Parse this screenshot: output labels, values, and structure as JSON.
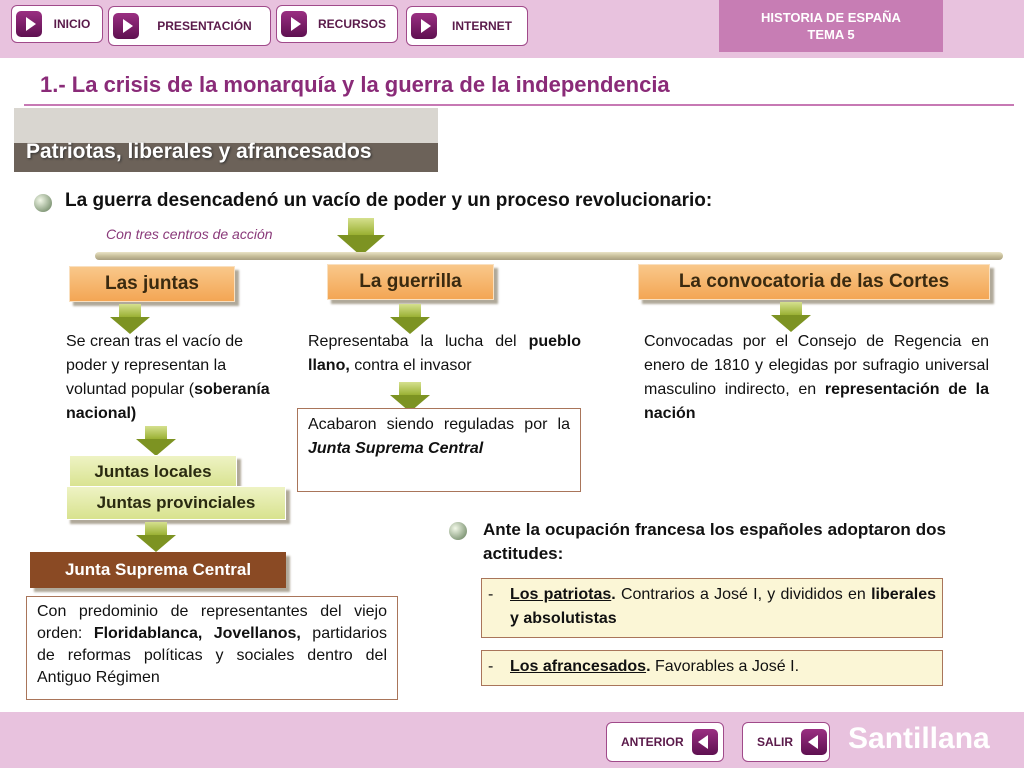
{
  "nav": {
    "inicio": "INICIO",
    "presentacion": "PRESENTACIÓN",
    "recursos": "RECURSOS",
    "internet": "INTERNET"
  },
  "tema": {
    "line1": "HISTORIA DE ESPAÑA",
    "line2": "TEMA 5"
  },
  "title": "1.- La crisis de la monarquía y la guerra de la independencia",
  "section": "Patriotas, liberales y afrancesados",
  "lead": "La guerra desencadenó un vacío de poder y un proceso revolucionario:",
  "sub": "Con tres centros de acción",
  "centros": {
    "juntas": "Las juntas",
    "guerrilla": "La guerrilla",
    "cortes": "La convocatoria de las Cortes"
  },
  "juntas_text": {
    "p1": "Se crean tras el vacío de poder y representan la voluntad popular (",
    "bold": "soberanía nacional)"
  },
  "guerrilla_text": {
    "p1": "Representaba la lucha del ",
    "bold": "pueblo llano,",
    "p2": " contra el invasor"
  },
  "guerrilla_box": {
    "p1": "Acabaron siendo reguladas por la ",
    "italic": "Junta Suprema Central"
  },
  "cortes_text": {
    "p1": "Convocadas por el Consejo de Regencia en enero de 1810 y elegidas por sufragio universal masculino indirecto, en ",
    "bold": "representación de la nación"
  },
  "juntas_locales": "Juntas locales",
  "juntas_provinciales": "Juntas provinciales",
  "junta_suprema": "Junta Suprema Central",
  "suprema_box": {
    "p1": "Con predominio de representantes del viejo orden: ",
    "bold": "Floridablanca, Jovellanos,",
    "p2": " partidarios de reformas políticas y sociales dentro del Antiguo Régimen"
  },
  "actitudes": "Ante la ocupación francesa los españoles adoptaron dos actitudes:",
  "patriotas": {
    "dash": "-",
    "name": "Los patriotas",
    "dot": ".",
    "p1": " Contrarios a José I, y divididos en ",
    "bold": "liberales y absolutistas"
  },
  "afrancesados": {
    "dash": "-",
    "name": "Los afrancesados",
    "dot": ".",
    "p1": " Favorables a José I."
  },
  "footer": {
    "anterior": "ANTERIOR",
    "salir": "SALIR",
    "brand": "Santillana"
  }
}
